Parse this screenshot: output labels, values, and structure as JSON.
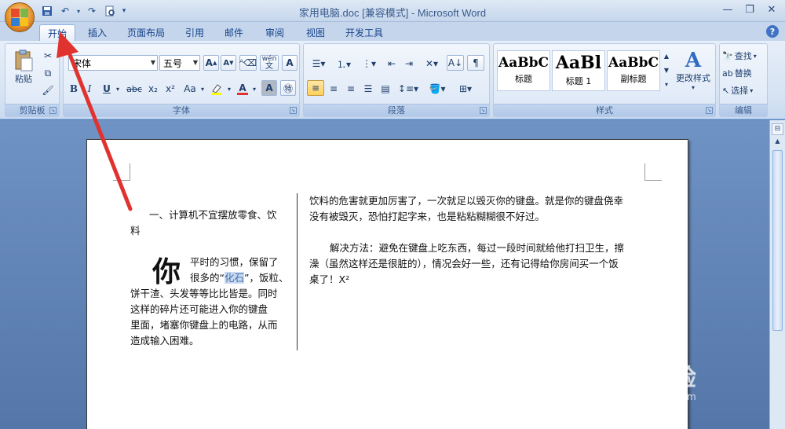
{
  "window": {
    "title": "家用电脑.doc [兼容模式] - Microsoft Word"
  },
  "tabs": [
    {
      "label": "开始",
      "active": true
    },
    {
      "label": "插入"
    },
    {
      "label": "页面布局"
    },
    {
      "label": "引用"
    },
    {
      "label": "邮件"
    },
    {
      "label": "审阅"
    },
    {
      "label": "视图"
    },
    {
      "label": "开发工具"
    }
  ],
  "ribbon": {
    "clipboard": {
      "paste_label": "粘贴",
      "group_label": "剪贴板"
    },
    "font": {
      "font_name": "宋体",
      "font_size": "五号",
      "group_label": "字体",
      "wen_label": "wén",
      "bold": "B",
      "italic": "I",
      "underline": "U",
      "strike": "abc",
      "sub": "x₂",
      "sup": "x²",
      "case": "Aa",
      "char_a": "A"
    },
    "paragraph": {
      "group_label": "段落"
    },
    "styles": {
      "items": [
        {
          "sample": "AaBbC",
          "name": "标题"
        },
        {
          "sample": "AaBl",
          "name": "标题 1"
        },
        {
          "sample": "AaBbC",
          "name": "副标题"
        }
      ],
      "change_label": "更改样式",
      "group_label": "样式"
    },
    "editing": {
      "find": "查找",
      "replace": "替换",
      "select": "选择",
      "group_label": "编辑"
    }
  },
  "document": {
    "left_col": {
      "heading": "一、计算机不宜摆放零食、饮",
      "heading_cont": "料",
      "dropcap": "你",
      "line1": "平时的习惯，保留了",
      "line2_pre": "很多的“",
      "line2_sel": "化石",
      "line2_post": "”，饭粒、",
      "line3": "饼干渣、头发等等比比皆是。同时",
      "line4": "这样的碎片还可能进入你的键盘",
      "line5": "里面，堵塞你键盘上的电路，从而",
      "line6": "造成输入困难。"
    },
    "right_col": {
      "p1_line1": "饮料的危害就更加厉害了，一次就足以毁灭你的键盘。就是你的键盘侥幸",
      "p1_line2": "没有被毁灭，恐怕打起字来，也是粘粘糊糊很不好过。",
      "p2_line1": "解决方法：避免在键盘上吃东西，每过一段时间就给他打扫卫生，擦",
      "p2_line2": "澡（虽然这样还是很脏的），情况会好一些，还有记得给你房间买一个饭",
      "p2_line3": "桌了！X²"
    }
  },
  "watermark": {
    "brand": "Bai  经验",
    "url": "jingyan.baidu.com"
  },
  "colors": {
    "accent_arrow": "#e0322e"
  }
}
